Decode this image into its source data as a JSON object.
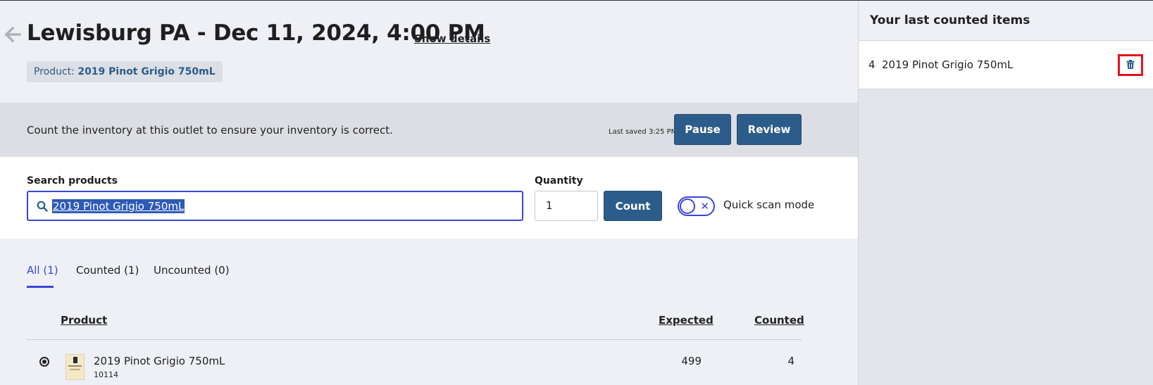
{
  "header": {
    "title": "Lewisburg PA - Dec 11, 2024, 4:00 PM",
    "show_details_label": "Show details",
    "product_badge_prefix": "Product: ",
    "product_badge_value": "2019 Pinot Grigio 750mL"
  },
  "count_band": {
    "description": "Count the inventory at this outlet to ensure your inventory is correct.",
    "last_saved": "Last saved 3:25 PM",
    "pause_label": "Pause",
    "review_label": "Review"
  },
  "search": {
    "label": "Search products",
    "value": "2019 Pinot Grigio 750mL",
    "quantity_label": "Quantity",
    "quantity_value": "1",
    "count_label": "Count",
    "quick_scan_label": "Quick scan mode",
    "quick_scan_enabled": false
  },
  "tabs": [
    {
      "label": "All (1)",
      "active": true
    },
    {
      "label": "Counted (1)",
      "active": false
    },
    {
      "label": "Uncounted (0)",
      "active": false
    }
  ],
  "table": {
    "columns": {
      "product": "Product",
      "expected": "Expected",
      "counted": "Counted"
    },
    "rows": [
      {
        "name": "2019 Pinot Grigio 750mL",
        "sku": "10114",
        "expected": "499",
        "counted": "4"
      }
    ]
  },
  "sidebar": {
    "title": "Your last counted items",
    "items": [
      {
        "qty": "4",
        "name": "2019 Pinot Grigio 750mL",
        "action_icon": "trash-icon"
      }
    ]
  },
  "colors": {
    "primary_button": "#2c5d8a",
    "accent": "#3b45d6",
    "highlight_outline": "#e0141e",
    "selection": "#2e5ab8"
  }
}
